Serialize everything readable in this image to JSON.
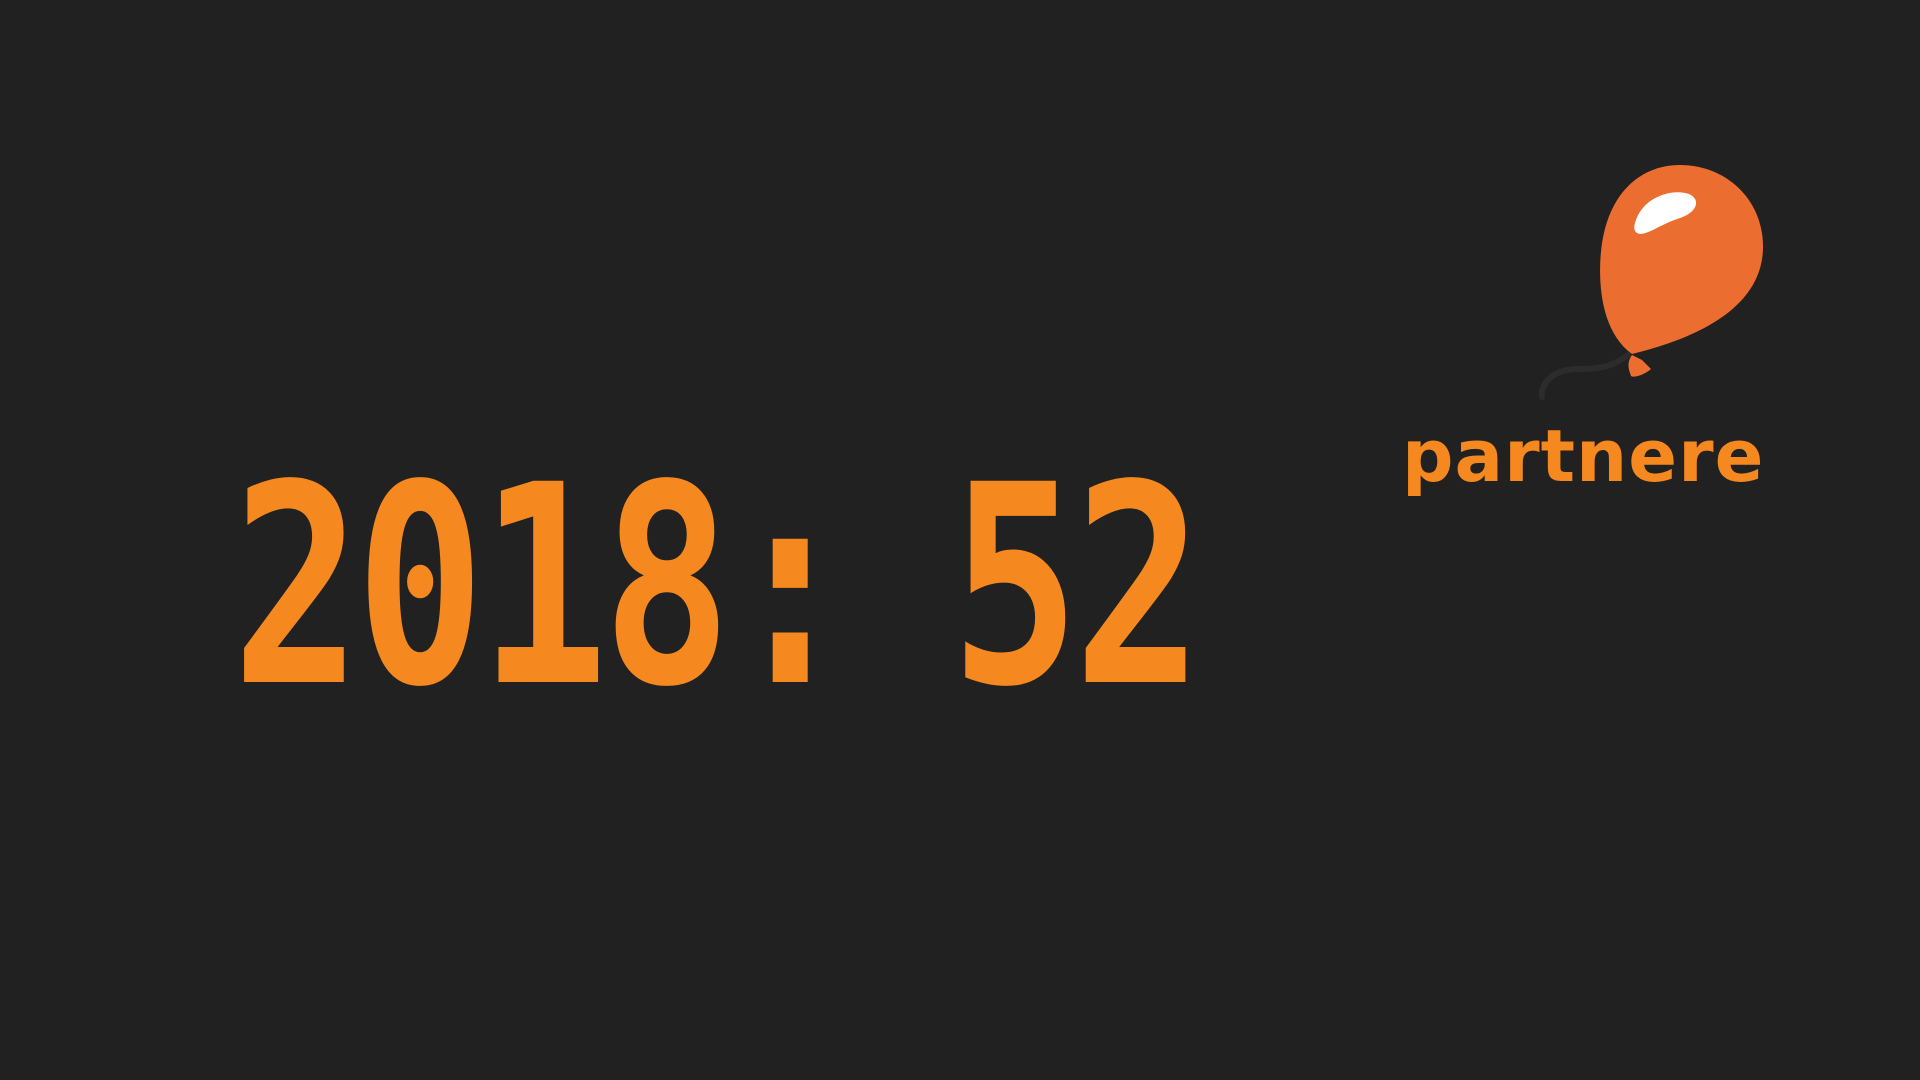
{
  "stat": {
    "year": "2018",
    "separator": ":",
    "count": "52",
    "caption": "partnere"
  },
  "decoration": {
    "icon": "balloon-icon",
    "balloon_color": "#ec6d30",
    "text_color": "#f5891f",
    "background": "#212121"
  }
}
